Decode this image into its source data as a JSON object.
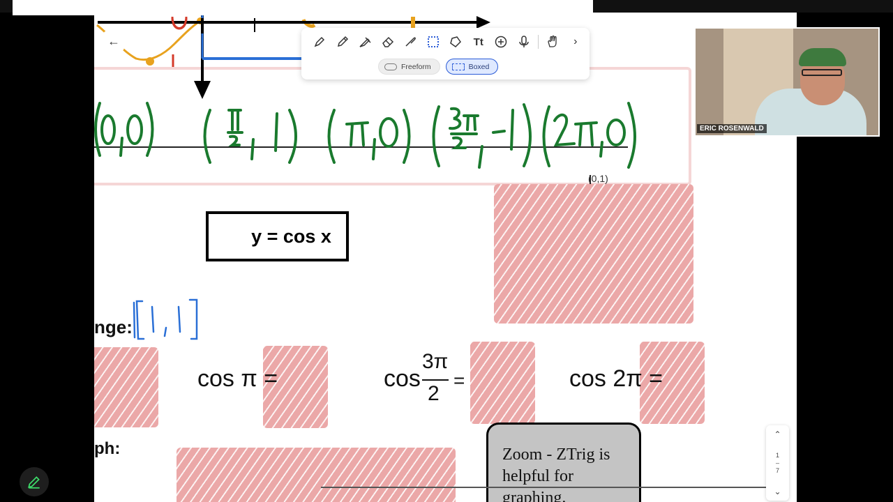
{
  "toolbar": {
    "tools": [
      "pen-icon",
      "pencil-icon",
      "highlighter-icon",
      "eraser-icon",
      "lasso-icon",
      "select-box-icon",
      "shapes-icon",
      "text-icon",
      "add-icon",
      "mic-icon",
      "hand-icon",
      "chevron-right-icon"
    ],
    "modes": [
      {
        "label": "Freeform",
        "active": false
      },
      {
        "label": "Boxed",
        "active": true
      }
    ]
  },
  "video": {
    "participant_name": "ERIC ROSENWALD"
  },
  "worksheet": {
    "points": [
      "(0,0)",
      "(π/2, 1)",
      "(π,0)",
      "(3π/2, -1)",
      "(2π,0)"
    ],
    "equation": "y = cos x",
    "range_label": "nge:",
    "range_value": "[-1,1]",
    "graph_label": "ph:",
    "cos_pi": "cos π =",
    "cos_3pi2_prefix": "cos",
    "cos_3pi2_num": "3π",
    "cos_3pi2_den": "2",
    "cos_2pi": "cos 2π =",
    "annotation_small": "(0,1)"
  },
  "callout": {
    "text": "Zoom - ZTrig is helpful for graphing."
  },
  "pager": {
    "current": "1",
    "total": "7"
  },
  "colors": {
    "ink_green": "#1a7a2e",
    "ink_blue": "#2a6fd6",
    "ink_orange": "#e8a21e",
    "hatch": "#eba8a8"
  }
}
